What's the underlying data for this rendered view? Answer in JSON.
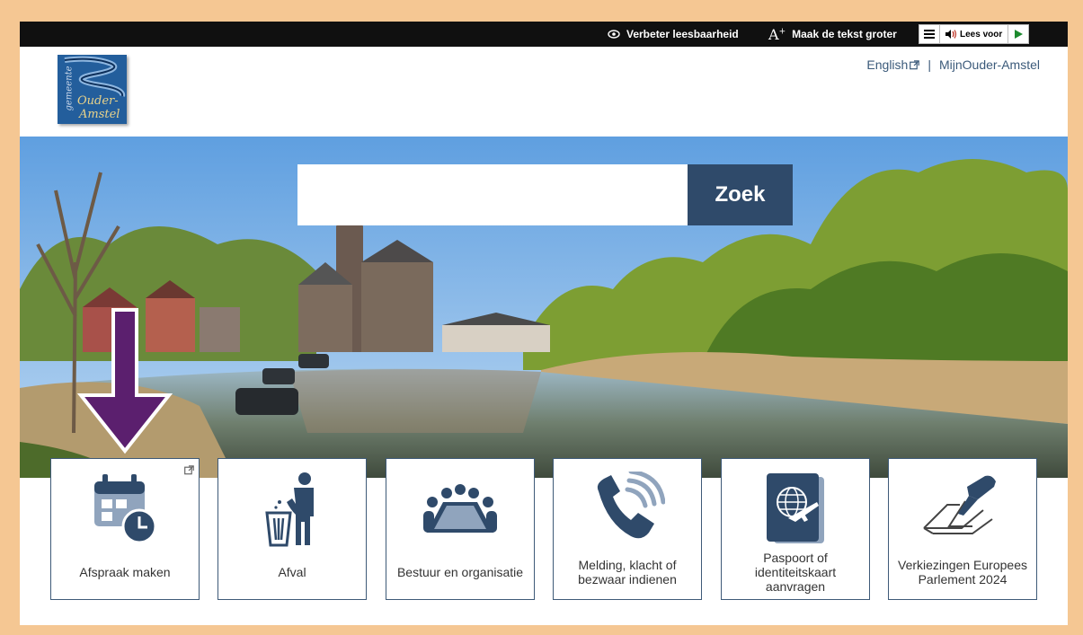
{
  "toolbar": {
    "readability": "Verbeter leesbaarheid",
    "text_bigger": "Maak de tekst groter",
    "read_aloud": "Lees voor"
  },
  "logo": {
    "line1": "gemeente",
    "line2": "Ouder-",
    "line3": "Amstel"
  },
  "header": {
    "english": "English",
    "separator": "|",
    "mijn": "MijnOuder-Amstel"
  },
  "search": {
    "value": "",
    "placeholder": "",
    "button": "Zoek"
  },
  "tiles": [
    {
      "label": "Afspraak maken",
      "icon": "calendar-clock-icon",
      "external": true
    },
    {
      "label": "Afval",
      "icon": "trash-person-icon",
      "external": false
    },
    {
      "label": "Bestuur en organisatie",
      "icon": "meeting-table-icon",
      "external": false
    },
    {
      "label": "Melding, klacht of bezwaar indienen",
      "icon": "phone-icon",
      "external": false
    },
    {
      "label": "Paspoort of identiteitskaart aanvragen",
      "icon": "passport-icon",
      "external": false
    },
    {
      "label": "Verkiezingen Europees Parlement 2024",
      "icon": "ballot-icon",
      "external": false
    }
  ],
  "colors": {
    "brand": "#2f4a6a",
    "frame": "#f5c793",
    "annotation_arrow": "#5b1f6e"
  }
}
